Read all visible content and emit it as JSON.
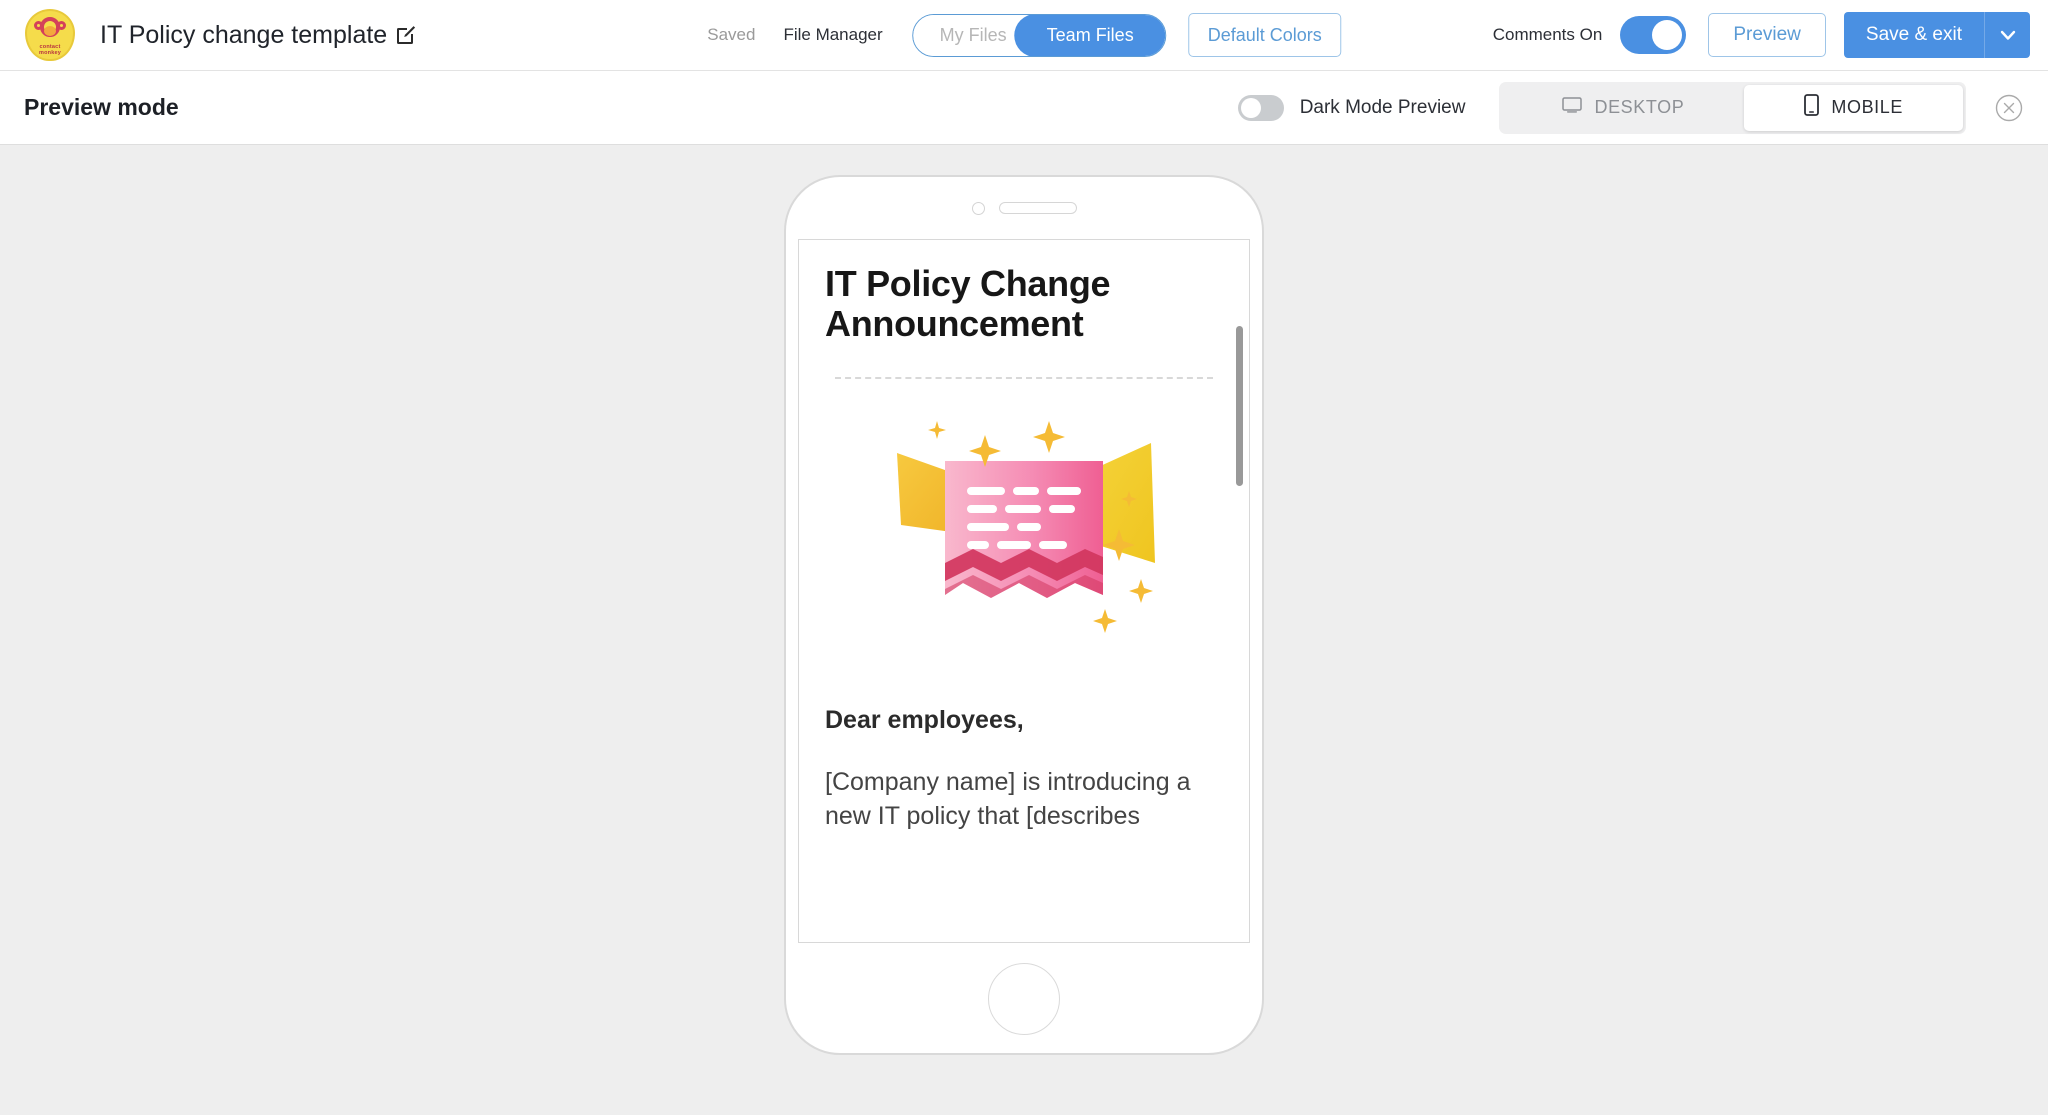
{
  "topbar": {
    "logo": {
      "name": "contactmonkey-logo",
      "line1": "contact",
      "line2": "monkey"
    },
    "document_title": "IT Policy change template",
    "edit_icon": "pencil-edit-icon",
    "saved_status": "Saved",
    "file_manager_label": "File Manager",
    "files_toggle": {
      "my_files_label": "My Files",
      "team_files_label": "Team Files",
      "active": "Team Files"
    },
    "default_colors_label": "Default Colors",
    "comments_label": "Comments On",
    "comments_toggle_state": "on",
    "preview_label": "Preview",
    "save_exit_label": "Save & exit",
    "save_caret_icon": "chevron-down-icon",
    "accent_blue": "#4a90e2",
    "outline_blue": "#5b9bd5"
  },
  "previewbar": {
    "title": "Preview mode",
    "dark_mode_label": "Dark Mode Preview",
    "dark_mode_state": "off",
    "devices": [
      {
        "label": "DESKTOP",
        "icon": "monitor-icon",
        "active": false
      },
      {
        "label": "MOBILE",
        "icon": "mobile-phone-icon",
        "active": true
      }
    ],
    "close_icon": "close-circle-icon",
    "canvas_background": "#eeeeee"
  },
  "email": {
    "heading": "IT Policy Change Announcement",
    "greeting": "Dear employees,",
    "paragraph": "[Company name] is introducing a new IT policy that [describes",
    "illustration": {
      "name": "announcement-megaphone-illustration",
      "banner_color": "#f06292",
      "banner_color_light": "#f8a5c2",
      "megaphone_color": "#f5d332",
      "zigzag_color": "#d1365e",
      "star_color": "#f5bb35",
      "star_count": 7
    },
    "scrollbar_color": "#999999"
  }
}
